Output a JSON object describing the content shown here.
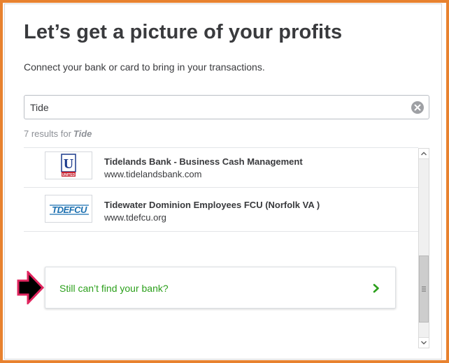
{
  "header": {
    "title": "Let’s get a picture of your profits",
    "subtitle": "Connect your bank or card to bring in your transactions."
  },
  "search": {
    "value": "Tide",
    "clear_icon": "clear-circle-x-icon"
  },
  "results": {
    "prefix": "7 results for",
    "query": "Tide",
    "items": [
      {
        "name": "Tidelands Bank - Business Cash Management",
        "url": "www.tidelandsbank.com",
        "logo_text": "U",
        "logo_caption": "UNITED"
      },
      {
        "name": "Tidewater Dominion Employees FCU (Norfolk VA )",
        "url": "www.tdefcu.org",
        "logo_text": "TDEFCU"
      }
    ]
  },
  "fallback": {
    "label": "Still can’t find your bank?",
    "icon": "chevron-right-icon"
  },
  "colors": {
    "frame_border": "#e8822f",
    "accent_green": "#2ca01c",
    "pointer_fill": "#000000",
    "pointer_outline": "#e0245e",
    "logo_navy": "#1b3a8c",
    "logo_red": "#c8202f",
    "logo_teal": "#1a6fb0"
  }
}
